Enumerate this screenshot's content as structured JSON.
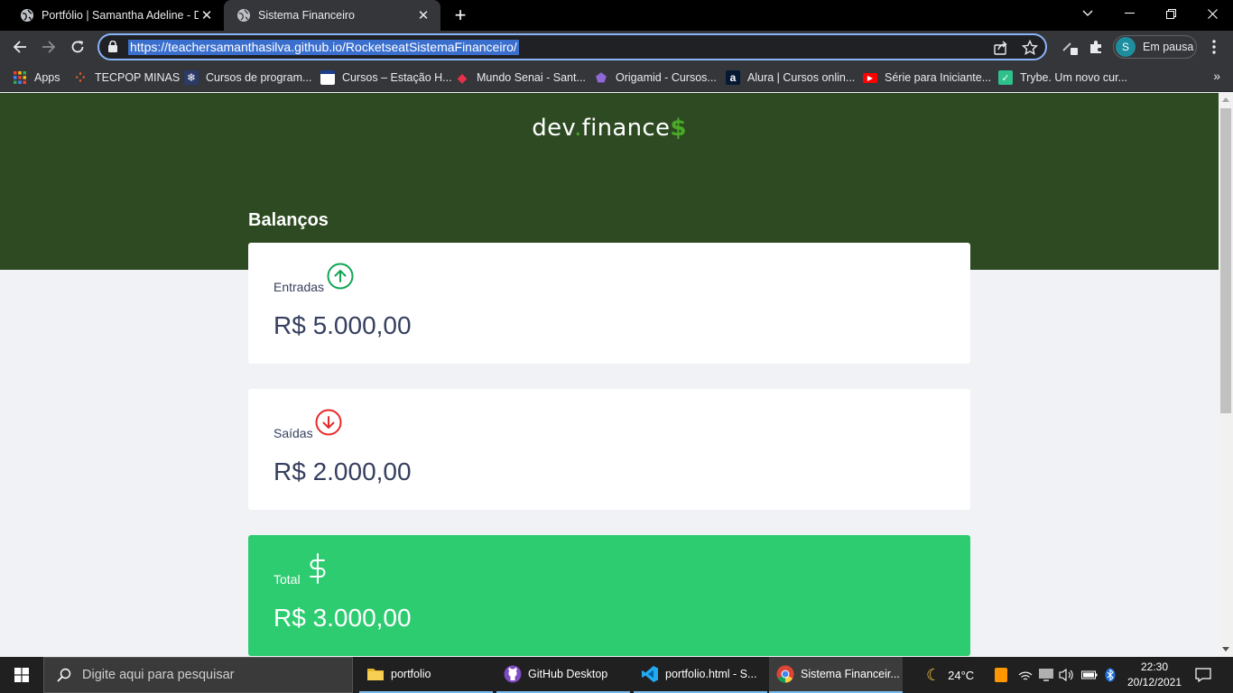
{
  "browser": {
    "tabs": [
      {
        "title": "Portfólio | Samantha Adeline - De",
        "active": false
      },
      {
        "title": "Sistema Financeiro",
        "active": true
      }
    ],
    "url": "https://teachersamanthasilva.github.io/RocketseatSistemaFinanceiro/",
    "profile_label": "Em pausa",
    "profile_initial": "S",
    "bookmarks": [
      {
        "label": "Apps",
        "icon": "apps-grid-icon"
      },
      {
        "label": "TECPOP MINAS",
        "icon": "tecpop-icon"
      },
      {
        "label": "Cursos de program...",
        "icon": "snowflake-icon"
      },
      {
        "label": "Cursos – Estação H...",
        "icon": "estacao-icon"
      },
      {
        "label": "Mundo Senai - Sant...",
        "icon": "senai-icon"
      },
      {
        "label": "Origamid - Cursos...",
        "icon": "origamid-icon"
      },
      {
        "label": "Alura | Cursos onlin...",
        "icon": "alura-icon"
      },
      {
        "label": "Série para Iniciante...",
        "icon": "youtube-icon"
      },
      {
        "label": "Trybe. Um novo cur...",
        "icon": "trybe-icon"
      }
    ]
  },
  "page": {
    "logo": {
      "part1": "dev",
      "dot": ".",
      "part2": "finance",
      "dollar": "$"
    },
    "section_title": "Balanços",
    "cards": {
      "income": {
        "label": "Entradas",
        "amount": "R$ 5.000,00",
        "icon": "arrow-up-circle-icon",
        "color": "#12a454"
      },
      "expense": {
        "label": "Saídas",
        "amount": "R$ 2.000,00",
        "icon": "arrow-down-circle-icon",
        "color": "#e92929"
      },
      "total": {
        "label": "Total",
        "amount": "R$ 3.000,00",
        "icon": "dollar-sign-icon",
        "color": "#2ecc71"
      }
    },
    "colors": {
      "header": "#2d4a22",
      "background": "#f0f2f5",
      "accent": "#49aa26",
      "text": "#363f5f"
    }
  },
  "taskbar": {
    "search_placeholder": "Digite aqui para pesquisar",
    "items": [
      {
        "label": "portfolio",
        "icon": "folder-icon"
      },
      {
        "label": "GitHub Desktop",
        "icon": "github-icon"
      },
      {
        "label": "portfolio.html - S...",
        "icon": "vscode-icon"
      },
      {
        "label": "Sistema Financeir...",
        "icon": "chrome-icon"
      }
    ],
    "weather": "24°C",
    "time": "22:30",
    "date": "20/12/2021"
  }
}
